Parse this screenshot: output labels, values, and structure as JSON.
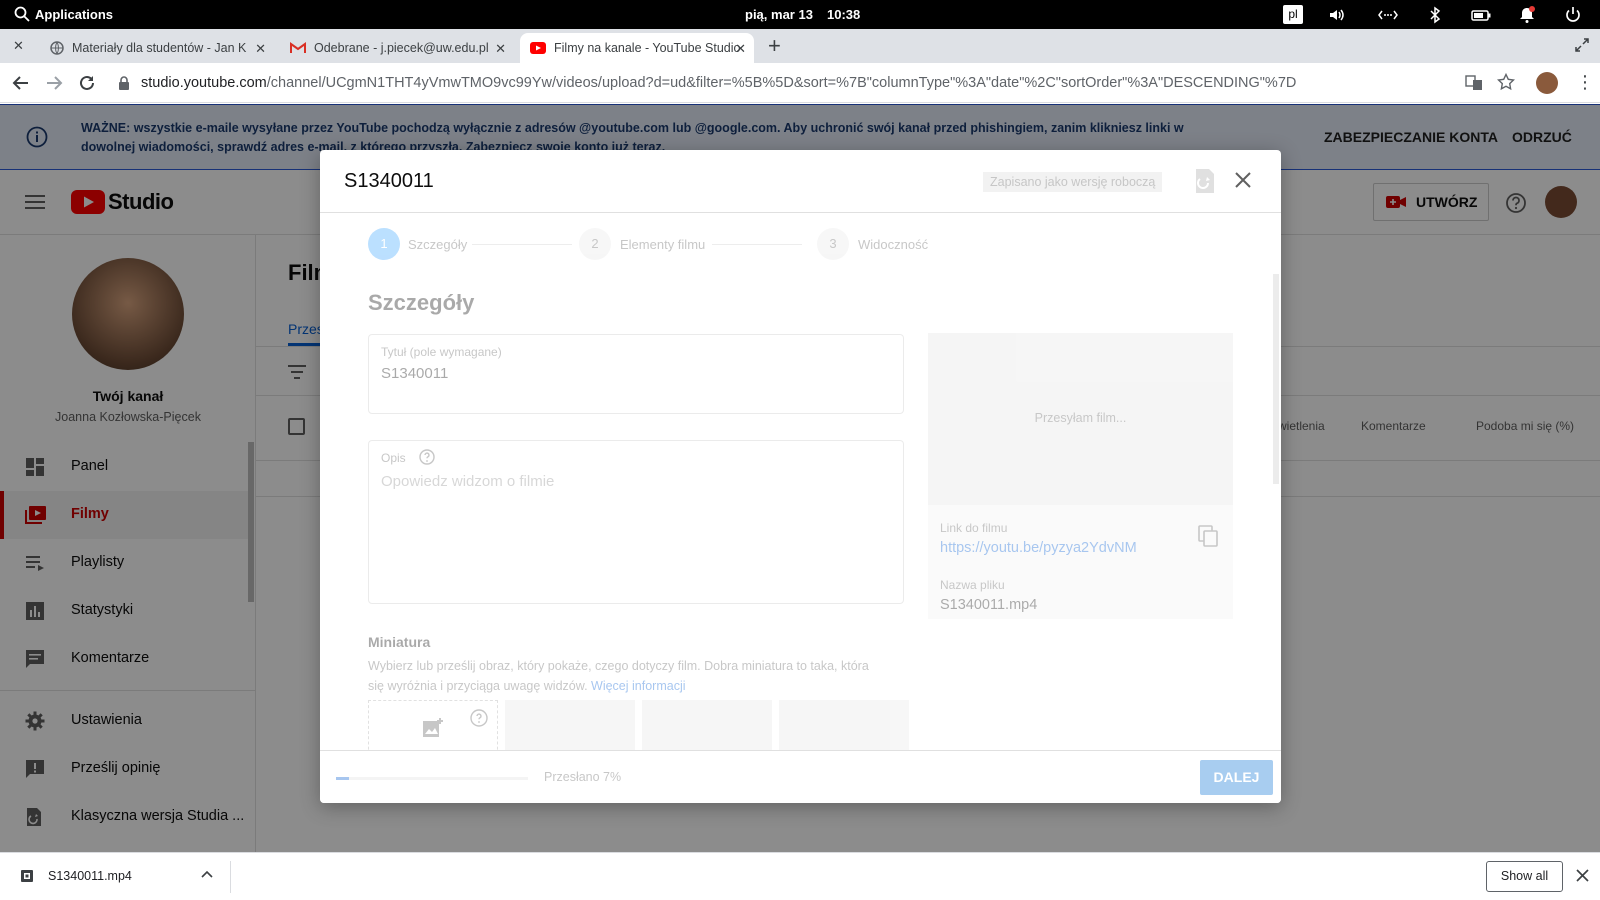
{
  "system": {
    "apps_label": "Applications",
    "datetime": "pią, mar 13",
    "time": "10:38",
    "keyboard_layout": "pl"
  },
  "tabs": [
    {
      "label": "Materiały dla studentów - Jan K",
      "active": false
    },
    {
      "label": "Odebrane - j.piecek@uw.edu.pl",
      "active": false
    },
    {
      "label": "Filmy na kanale - YouTube Studio",
      "active": true
    }
  ],
  "address": {
    "domain": "studio.youtube.com",
    "path": "/channel/UCgmN1THT4yVmwTMO9vc99Yw/videos/upload?d=ud&filter=%5B%5D&sort=%7B\"columnType\"%3A\"date\"%2C\"sortOrder\"%3A\"DESCENDING\"%7D"
  },
  "banner": {
    "message": "WAŻNE: wszystkie e-maile wysyłane przez YouTube pochodzą wyłącznie z adresów @youtube.com lub @google.com. Aby uchronić swój kanał przed phishingiem, zanim klikniesz linki w dowolnej wiadomości, sprawdź adres e-mail, z którego przyszła. Zabezpiecz swoje konto już teraz.",
    "secure_label": "ZABEZPIECZANIE KONTA",
    "dismiss_label": "ODRZUĆ"
  },
  "header": {
    "logo_text": "Studio",
    "create_label": "UTWÓRZ"
  },
  "channel": {
    "title": "Twój kanał",
    "name": "Joanna Kozłowska-Pięcek"
  },
  "sidebar": {
    "items": [
      {
        "label": "Panel",
        "icon": "dashboard-icon"
      },
      {
        "label": "Filmy",
        "icon": "videos-icon",
        "active": true
      },
      {
        "label": "Playlisty",
        "icon": "playlists-icon"
      },
      {
        "label": "Statystyki",
        "icon": "analytics-icon"
      },
      {
        "label": "Komentarze",
        "icon": "comments-icon"
      },
      {
        "label": "Ustawienia",
        "icon": "settings-icon"
      },
      {
        "label": "Prześlij opinię",
        "icon": "feedback-icon"
      },
      {
        "label": "Klasyczna wersja Studia ...",
        "icon": "classic-studio-icon"
      }
    ]
  },
  "page": {
    "title_partial": "Film",
    "tab_partial": "Przes",
    "col_views_partial": "yświetlenia",
    "col_comments": "Komentarze",
    "col_likes": "Podoba mi się (%)"
  },
  "dialog": {
    "title": "S1340011",
    "draft_status": "Zapisano jako wersję roboczą",
    "steps": [
      {
        "num": "1",
        "label": "Szczegóły"
      },
      {
        "num": "2",
        "label": "Elementy filmu"
      },
      {
        "num": "3",
        "label": "Widoczność"
      }
    ],
    "section_title": "Szczegóły",
    "title_field": {
      "label": "Tytuł (pole wymagane)",
      "value": "S1340011"
    },
    "description_field": {
      "label": "Opis",
      "placeholder": "Opowiedz widzom o filmie"
    },
    "thumbnail": {
      "title": "Miniatura",
      "description": "Wybierz lub prześlij obraz, który pokaże, czego dotyczy film. Dobra miniatura to taka, która się wyróżnia i przyciąga uwagę widzów.",
      "more_link": "Więcej informacji"
    },
    "preview": {
      "uploading": "Przesyłam film...",
      "link_label": "Link do filmu",
      "link": "https://youtu.be/pyzya2YdvNM",
      "filename_label": "Nazwa pliku",
      "filename": "S1340011.mp4"
    },
    "footer": {
      "progress_text": "Przesłano 7%",
      "progress": 0.07,
      "next_label": "DALEJ"
    }
  },
  "downloads": {
    "file": "S1340011.mp4",
    "show_all": "Show all"
  },
  "colors": {
    "brand_red": "#ff0000",
    "accent_blue": "#065fd4",
    "banner_bg": "#e3ecf8"
  }
}
